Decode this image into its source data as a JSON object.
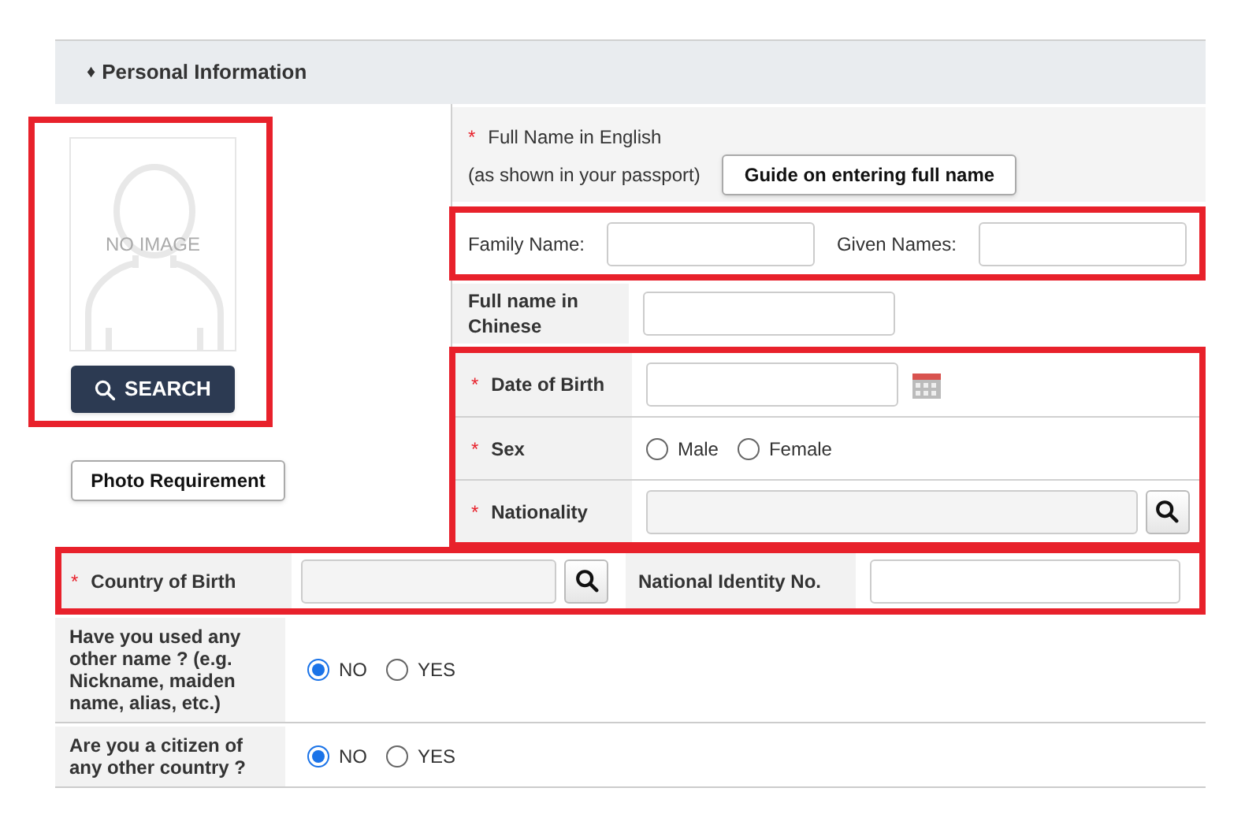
{
  "section": {
    "bullet": "♦",
    "title": "Personal Information"
  },
  "photo": {
    "placeholder": "NO IMAGE",
    "search_button": "SEARCH",
    "requirement_button": "Photo Requirement"
  },
  "full_name_english": {
    "required_mark": "*",
    "label": "Full Name in English",
    "note": "(as shown in your passport)",
    "guide_button": "Guide on entering full name"
  },
  "name_parts": [
    {
      "label": "Family Name:"
    },
    {
      "label": "Given Names:"
    }
  ],
  "fields": [
    {
      "kind": "text",
      "label": "Full name in Chinese"
    },
    {
      "kind": "date",
      "label": "Date of Birth",
      "required_mark": "*"
    },
    {
      "kind": "radio",
      "label": "Sex",
      "required_mark": "*",
      "options": [
        {
          "label": "Male",
          "selected": false
        },
        {
          "label": "Female",
          "selected": false
        }
      ]
    },
    {
      "kind": "lookup",
      "label": "Nationality",
      "required_mark": "*"
    }
  ],
  "country_of_birth": {
    "label": "Country of Birth",
    "required_mark": "*"
  },
  "national_identity": {
    "label": "National Identity No."
  },
  "questions": [
    {
      "label": "Have you used any other name ? (e.g. Nickname, maiden name, alias, etc.)",
      "options": [
        {
          "label": "NO",
          "selected": true
        },
        {
          "label": "YES",
          "selected": false
        }
      ]
    },
    {
      "label": "Are you a citizen of any other country ?",
      "options": [
        {
          "label": "NO",
          "selected": true
        },
        {
          "label": "YES",
          "selected": false
        }
      ]
    }
  ]
}
